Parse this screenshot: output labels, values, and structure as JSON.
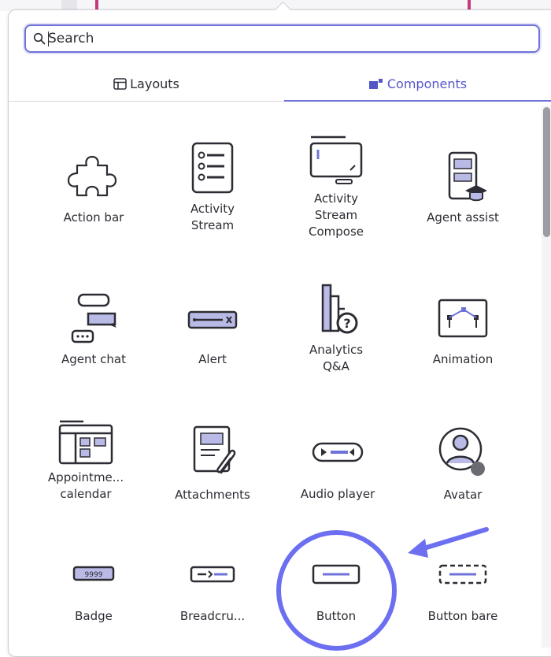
{
  "search": {
    "placeholder": "Search",
    "icon": "search-icon"
  },
  "tabs": [
    {
      "label": "Layouts",
      "icon": "layout-icon",
      "active": false
    },
    {
      "label": "Components",
      "icon": "components-icon",
      "active": true
    }
  ],
  "accent_color": "#6f73d9",
  "icon_color": "#2c2c34",
  "icon_fill": "#b9bbe6",
  "annotation_color": "#6b6ff0",
  "components": [
    {
      "label": "Action bar",
      "icon": "puzzle-icon"
    },
    {
      "label": "Activity\nStream",
      "icon": "checklist-icon"
    },
    {
      "label": "Activity\nStream\nCompose",
      "icon": "compose-icon"
    },
    {
      "label": "Agent assist",
      "icon": "agent-assist-icon"
    },
    {
      "label": "Agent chat",
      "icon": "chat-icon"
    },
    {
      "label": "Alert",
      "icon": "alert-icon"
    },
    {
      "label": "Analytics\nQ&A",
      "icon": "analytics-qa-icon"
    },
    {
      "label": "Animation",
      "icon": "animation-icon"
    },
    {
      "label": "Appointme...\ncalendar",
      "icon": "calendar-icon"
    },
    {
      "label": "Attachments",
      "icon": "attachment-icon"
    },
    {
      "label": "Audio player",
      "icon": "audio-player-icon"
    },
    {
      "label": "Avatar",
      "icon": "avatar-icon"
    },
    {
      "label": "Badge",
      "icon": "badge-icon",
      "badge_text": "9999"
    },
    {
      "label": "Breadcru...",
      "icon": "breadcrumb-icon"
    },
    {
      "label": "Button",
      "icon": "button-icon",
      "highlighted": true
    },
    {
      "label": "Button bare",
      "icon": "button-bare-icon"
    }
  ]
}
